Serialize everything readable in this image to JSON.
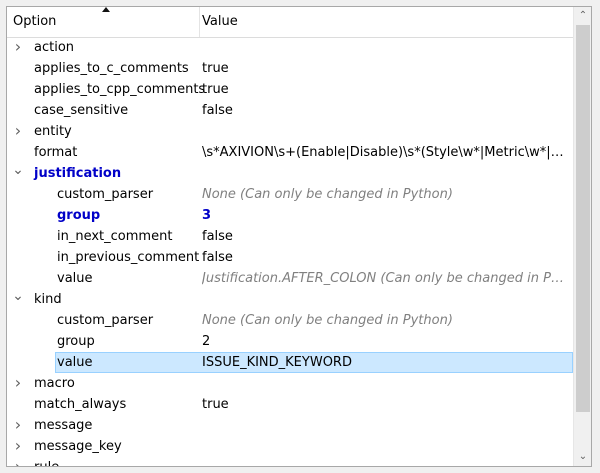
{
  "header": {
    "option_label": "Option",
    "value_label": "Value"
  },
  "rows": [
    {
      "level": 0,
      "expander": "collapsed",
      "name": "action",
      "value": ""
    },
    {
      "level": 0,
      "expander": "none",
      "name": "applies_to_c_comments",
      "value": "true"
    },
    {
      "level": 0,
      "expander": "none",
      "name": "applies_to_cpp_comments",
      "value": "true"
    },
    {
      "level": 0,
      "expander": "none",
      "name": "case_sensitive",
      "value": "false"
    },
    {
      "level": 0,
      "expander": "collapsed",
      "name": "entity",
      "value": ""
    },
    {
      "level": 0,
      "expander": "none",
      "name": "format",
      "value": "\\s*AXIVION\\s+(Enable|Disable)\\s*(Style\\w*|Metric\\w*|Dea..."
    },
    {
      "level": 0,
      "expander": "expanded",
      "name": "justification",
      "value": "",
      "style": "bold-blue"
    },
    {
      "level": 1,
      "expander": "none",
      "name": "custom_parser",
      "value": "None (Can only be changed in Python)",
      "value_style": "muted"
    },
    {
      "level": 1,
      "expander": "none",
      "name": "group",
      "value": "3",
      "style": "bold-blue",
      "value_style": "bold-blue"
    },
    {
      "level": 1,
      "expander": "none",
      "name": "in_next_comment",
      "value": "false"
    },
    {
      "level": 1,
      "expander": "none",
      "name": "in_previous_comment",
      "value": "false"
    },
    {
      "level": 1,
      "expander": "none",
      "name": "value",
      "value": "Justification.AFTER_COLON (Can only be changed in Pytho...",
      "value_style": "muted"
    },
    {
      "level": 0,
      "expander": "expanded",
      "name": "kind",
      "value": ""
    },
    {
      "level": 1,
      "expander": "none",
      "name": "custom_parser",
      "value": "None (Can only be changed in Python)",
      "value_style": "muted"
    },
    {
      "level": 1,
      "expander": "none",
      "name": "group",
      "value": "2"
    },
    {
      "level": 1,
      "expander": "none",
      "name": "value",
      "value": "ISSUE_KIND_KEYWORD",
      "selected": true
    },
    {
      "level": 0,
      "expander": "collapsed",
      "name": "macro",
      "value": ""
    },
    {
      "level": 0,
      "expander": "none",
      "name": "match_always",
      "value": "true"
    },
    {
      "level": 0,
      "expander": "collapsed",
      "name": "message",
      "value": ""
    },
    {
      "level": 0,
      "expander": "collapsed",
      "name": "message_key",
      "value": ""
    },
    {
      "level": 0,
      "expander": "collapsed",
      "name": "rule",
      "value": ""
    }
  ],
  "icons": {
    "collapsed": "chevron-right-icon",
    "expanded": "chevron-down-icon",
    "scroll_up": "scroll-up-arrow-icon",
    "scroll_down": "scroll-down-arrow-icon",
    "sort": "sort-ascending-icon"
  },
  "colors": {
    "selection": "#cce8ff",
    "selection_border": "#99d1ff",
    "highlight_text": "#0000c8",
    "muted_text": "#808080"
  }
}
